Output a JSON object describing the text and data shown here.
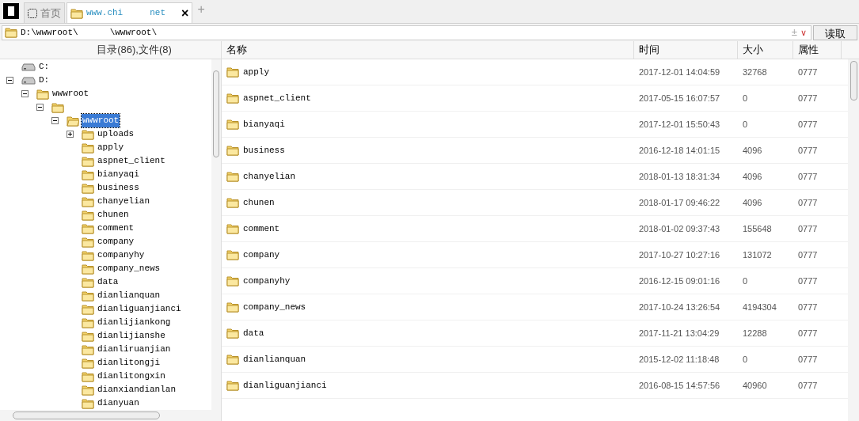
{
  "tabs": [
    {
      "kind": "home",
      "label": "首页",
      "selected": false
    },
    {
      "kind": "site",
      "label_parts": [
        "www.chi",
        "net"
      ],
      "selected": true,
      "close": "×"
    }
  ],
  "new_tab": "+",
  "address": {
    "path_parts": [
      "D:\\wwwroot\\",
      "\\wwwroot\\"
    ],
    "add": "±",
    "dropdown": "∨",
    "read_button": "读取"
  },
  "tree": {
    "summary": "目录(86),文件(8)",
    "nodes": [
      {
        "kind": "drive",
        "label": "C:",
        "selected": false
      },
      {
        "kind": "drive",
        "label": "D:",
        "expanded": true,
        "selected": false,
        "children": [
          {
            "kind": "folder",
            "label": "wwwroot",
            "expanded": true,
            "selected": false,
            "children": [
              {
                "kind": "folder",
                "expanded": true,
                "selected": false,
                "children": [
                  {
                    "kind": "folder",
                    "label": "wwwroot",
                    "expanded": true,
                    "selected": true,
                    "children": [
                      {
                        "kind": "folder",
                        "label": "uploads",
                        "expanded": false,
                        "selected": false
                      },
                      {
                        "kind": "folder",
                        "label": "apply",
                        "selected": false
                      },
                      {
                        "kind": "folder",
                        "label": "aspnet_client",
                        "selected": false
                      },
                      {
                        "kind": "folder",
                        "label": "bianyaqi",
                        "selected": false
                      },
                      {
                        "kind": "folder",
                        "label": "business",
                        "selected": false
                      },
                      {
                        "kind": "folder",
                        "label": "chanyelian",
                        "selected": false
                      },
                      {
                        "kind": "folder",
                        "label": "chunen",
                        "selected": false
                      },
                      {
                        "kind": "folder",
                        "label": "comment",
                        "selected": false
                      },
                      {
                        "kind": "folder",
                        "label": "company",
                        "selected": false
                      },
                      {
                        "kind": "folder",
                        "label": "companyhy",
                        "selected": false
                      },
                      {
                        "kind": "folder",
                        "label": "company_news",
                        "selected": false
                      },
                      {
                        "kind": "folder",
                        "label": "data",
                        "selected": false
                      },
                      {
                        "kind": "folder",
                        "label": "dianlianquan",
                        "selected": false
                      },
                      {
                        "kind": "folder",
                        "label": "dianliguanjianci",
                        "selected": false
                      },
                      {
                        "kind": "folder",
                        "label": "dianlijiankong",
                        "selected": false
                      },
                      {
                        "kind": "folder",
                        "label": "dianlijianshe",
                        "selected": false
                      },
                      {
                        "kind": "folder",
                        "label": "dianliruanjian",
                        "selected": false
                      },
                      {
                        "kind": "folder",
                        "label": "dianlitongji",
                        "selected": false
                      },
                      {
                        "kind": "folder",
                        "label": "dianlitongxin",
                        "selected": false
                      },
                      {
                        "kind": "folder",
                        "label": "dianxiandianlan",
                        "selected": false
                      },
                      {
                        "kind": "folder",
                        "label": "dianyuan",
                        "selected": false
                      }
                    ]
                  }
                ]
              }
            ]
          }
        ]
      }
    ]
  },
  "table": {
    "columns": [
      "名称",
      "时间",
      "大小",
      "属性"
    ],
    "rows": [
      {
        "name": "apply",
        "time": "2017-12-01 14:04:59",
        "size": "32768",
        "attr": "0777"
      },
      {
        "name": "aspnet_client",
        "time": "2017-05-15 16:07:57",
        "size": "0",
        "attr": "0777"
      },
      {
        "name": "bianyaqi",
        "time": "2017-12-01 15:50:43",
        "size": "0",
        "attr": "0777"
      },
      {
        "name": "business",
        "time": "2016-12-18 14:01:15",
        "size": "4096",
        "attr": "0777"
      },
      {
        "name": "chanyelian",
        "time": "2018-01-13 18:31:34",
        "size": "4096",
        "attr": "0777"
      },
      {
        "name": "chunen",
        "time": "2018-01-17 09:46:22",
        "size": "4096",
        "attr": "0777"
      },
      {
        "name": "comment",
        "time": "2018-01-02 09:37:43",
        "size": "155648",
        "attr": "0777"
      },
      {
        "name": "company",
        "time": "2017-10-27 10:27:16",
        "size": "131072",
        "attr": "0777"
      },
      {
        "name": "companyhy",
        "time": "2016-12-15 09:01:16",
        "size": "0",
        "attr": "0777"
      },
      {
        "name": "company_news",
        "time": "2017-10-24 13:26:54",
        "size": "4194304",
        "attr": "0777"
      },
      {
        "name": "data",
        "time": "2017-11-21 13:04:29",
        "size": "12288",
        "attr": "0777"
      },
      {
        "name": "dianlianquan",
        "time": "2015-12-02 11:18:48",
        "size": "0",
        "attr": "0777"
      },
      {
        "name": "dianliguanjianci",
        "time": "2016-08-15 14:57:56",
        "size": "40960",
        "attr": "0777"
      }
    ]
  }
}
